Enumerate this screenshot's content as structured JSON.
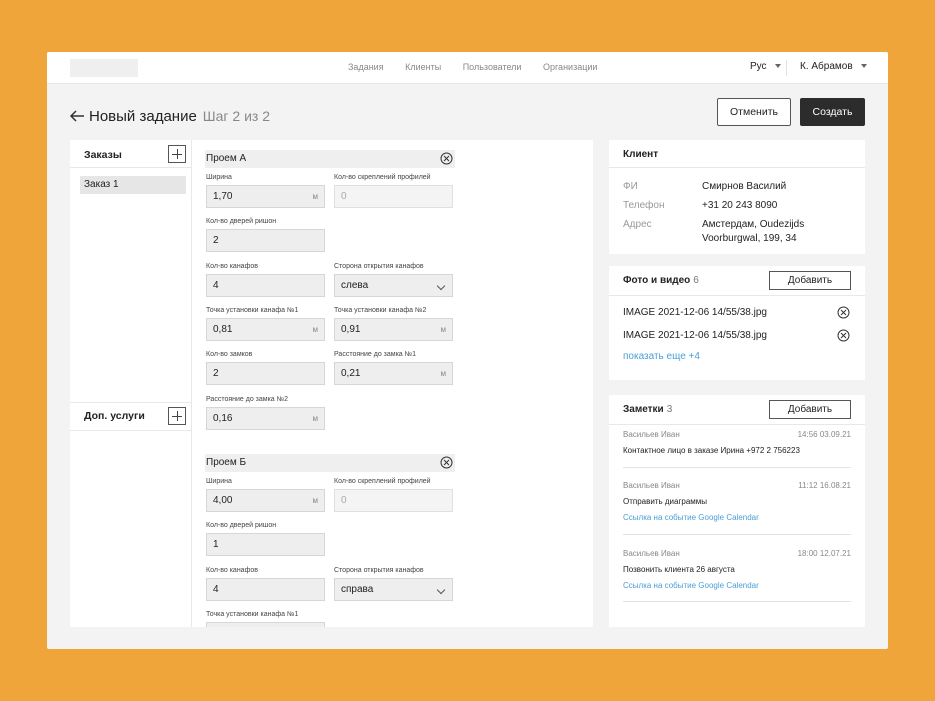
{
  "topbar": {
    "nav": [
      "Задания",
      "Клиенты",
      "Пользователи",
      "Организации"
    ],
    "lang": "Рус",
    "user": "К. Абрамов"
  },
  "header": {
    "title": "Новый задание",
    "step": "Шаг 2 из 2",
    "cancel": "Отменить",
    "create": "Создать"
  },
  "orders": {
    "title": "Заказы",
    "items": [
      "Заказ 1"
    ],
    "services_title": "Доп. услуги"
  },
  "openings": [
    {
      "name": "Проем А",
      "width_label": "Ширина",
      "width": "1,70",
      "unit": "м",
      "fasteners_label": "Кол-во скреплений профилей",
      "fasteners_placeholder": "0",
      "doors_label": "Кол-во дверей ришон",
      "doors": "2",
      "canopies_label": "Кол-во канафов",
      "canopies": "4",
      "side_label": "Сторона открытия канафов",
      "side": "слева",
      "p1_label": "Точка установки канафа №1",
      "p1": "0,81",
      "p2_label": "Точка установки канафа №2",
      "p2": "0,91",
      "locks_label": "Кол-во замков",
      "locks": "2",
      "lock1_label": "Расстояние до замка №1",
      "lock1": "0,21",
      "lock2_label": "Расстояние до замка №2",
      "lock2": "0,16"
    },
    {
      "name": "Проем Б",
      "width_label": "Ширина",
      "width": "4,00",
      "unit": "м",
      "fasteners_label": "Кол-во скреплений профилей",
      "fasteners_placeholder": "0",
      "doors_label": "Кол-во дверей ришон",
      "doors": "1",
      "canopies_label": "Кол-во канафов",
      "canopies": "4",
      "side_label": "Сторона открытия канафов",
      "side": "справа",
      "p1_label": "Точка установки канафа №1"
    }
  ],
  "client": {
    "title": "Клиент",
    "name_label": "ФИ",
    "name": "Смирнов Василий",
    "phone_label": "Телефон",
    "phone": "+31 20 243 8090",
    "address_label": "Адрес",
    "address_line1": "Амстердам, Oudezijds",
    "address_line2": "Voorburgwal, 199, 34"
  },
  "media": {
    "title": "Фото и видео",
    "count": "6",
    "add": "Добавить",
    "files": [
      "IMAGE 2021-12-06 14/55/38.jpg",
      "IMAGE 2021-12-06 14/55/38.jpg"
    ],
    "more": "показать еще +4"
  },
  "notes": {
    "title": "Заметки",
    "count": "3",
    "add": "Добавить",
    "items": [
      {
        "author": "Васильев Иван",
        "time": "14:56 03.09.21",
        "text": "Контактное лицо в заказе Ирина +972 2 756223",
        "link": ""
      },
      {
        "author": "Васильев Иван",
        "time": "11:12 16.08.21",
        "text": "Отправить диаграммы",
        "link": "Ссылка на событие Google Calendar"
      },
      {
        "author": "Васильев Иван",
        "time": "18:00 12.07.21",
        "text": "Позвонить клиента 26 августа",
        "link": "Ссылка на событие Google Calendar"
      }
    ]
  },
  "colors": {
    "background": "#f0a53a",
    "primary_button": "#2c2c2c",
    "link": "#4a9fd8"
  }
}
